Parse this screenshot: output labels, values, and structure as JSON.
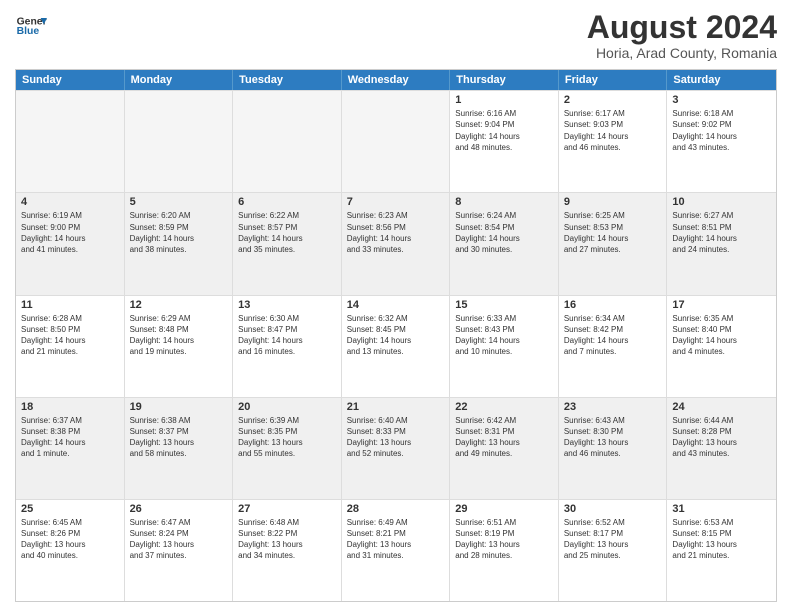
{
  "header": {
    "logo_line1": "General",
    "logo_line2": "Blue",
    "main_title": "August 2024",
    "subtitle": "Horia, Arad County, Romania"
  },
  "days_of_week": [
    "Sunday",
    "Monday",
    "Tuesday",
    "Wednesday",
    "Thursday",
    "Friday",
    "Saturday"
  ],
  "weeks": [
    [
      {
        "num": "",
        "info": "",
        "empty": true
      },
      {
        "num": "",
        "info": "",
        "empty": true
      },
      {
        "num": "",
        "info": "",
        "empty": true
      },
      {
        "num": "",
        "info": "",
        "empty": true
      },
      {
        "num": "1",
        "info": "Sunrise: 6:16 AM\nSunset: 9:04 PM\nDaylight: 14 hours\nand 48 minutes.",
        "empty": false
      },
      {
        "num": "2",
        "info": "Sunrise: 6:17 AM\nSunset: 9:03 PM\nDaylight: 14 hours\nand 46 minutes.",
        "empty": false
      },
      {
        "num": "3",
        "info": "Sunrise: 6:18 AM\nSunset: 9:02 PM\nDaylight: 14 hours\nand 43 minutes.",
        "empty": false
      }
    ],
    [
      {
        "num": "4",
        "info": "Sunrise: 6:19 AM\nSunset: 9:00 PM\nDaylight: 14 hours\nand 41 minutes.",
        "empty": false
      },
      {
        "num": "5",
        "info": "Sunrise: 6:20 AM\nSunset: 8:59 PM\nDaylight: 14 hours\nand 38 minutes.",
        "empty": false
      },
      {
        "num": "6",
        "info": "Sunrise: 6:22 AM\nSunset: 8:57 PM\nDaylight: 14 hours\nand 35 minutes.",
        "empty": false
      },
      {
        "num": "7",
        "info": "Sunrise: 6:23 AM\nSunset: 8:56 PM\nDaylight: 14 hours\nand 33 minutes.",
        "empty": false
      },
      {
        "num": "8",
        "info": "Sunrise: 6:24 AM\nSunset: 8:54 PM\nDaylight: 14 hours\nand 30 minutes.",
        "empty": false
      },
      {
        "num": "9",
        "info": "Sunrise: 6:25 AM\nSunset: 8:53 PM\nDaylight: 14 hours\nand 27 minutes.",
        "empty": false
      },
      {
        "num": "10",
        "info": "Sunrise: 6:27 AM\nSunset: 8:51 PM\nDaylight: 14 hours\nand 24 minutes.",
        "empty": false
      }
    ],
    [
      {
        "num": "11",
        "info": "Sunrise: 6:28 AM\nSunset: 8:50 PM\nDaylight: 14 hours\nand 21 minutes.",
        "empty": false
      },
      {
        "num": "12",
        "info": "Sunrise: 6:29 AM\nSunset: 8:48 PM\nDaylight: 14 hours\nand 19 minutes.",
        "empty": false
      },
      {
        "num": "13",
        "info": "Sunrise: 6:30 AM\nSunset: 8:47 PM\nDaylight: 14 hours\nand 16 minutes.",
        "empty": false
      },
      {
        "num": "14",
        "info": "Sunrise: 6:32 AM\nSunset: 8:45 PM\nDaylight: 14 hours\nand 13 minutes.",
        "empty": false
      },
      {
        "num": "15",
        "info": "Sunrise: 6:33 AM\nSunset: 8:43 PM\nDaylight: 14 hours\nand 10 minutes.",
        "empty": false
      },
      {
        "num": "16",
        "info": "Sunrise: 6:34 AM\nSunset: 8:42 PM\nDaylight: 14 hours\nand 7 minutes.",
        "empty": false
      },
      {
        "num": "17",
        "info": "Sunrise: 6:35 AM\nSunset: 8:40 PM\nDaylight: 14 hours\nand 4 minutes.",
        "empty": false
      }
    ],
    [
      {
        "num": "18",
        "info": "Sunrise: 6:37 AM\nSunset: 8:38 PM\nDaylight: 14 hours\nand 1 minute.",
        "empty": false
      },
      {
        "num": "19",
        "info": "Sunrise: 6:38 AM\nSunset: 8:37 PM\nDaylight: 13 hours\nand 58 minutes.",
        "empty": false
      },
      {
        "num": "20",
        "info": "Sunrise: 6:39 AM\nSunset: 8:35 PM\nDaylight: 13 hours\nand 55 minutes.",
        "empty": false
      },
      {
        "num": "21",
        "info": "Sunrise: 6:40 AM\nSunset: 8:33 PM\nDaylight: 13 hours\nand 52 minutes.",
        "empty": false
      },
      {
        "num": "22",
        "info": "Sunrise: 6:42 AM\nSunset: 8:31 PM\nDaylight: 13 hours\nand 49 minutes.",
        "empty": false
      },
      {
        "num": "23",
        "info": "Sunrise: 6:43 AM\nSunset: 8:30 PM\nDaylight: 13 hours\nand 46 minutes.",
        "empty": false
      },
      {
        "num": "24",
        "info": "Sunrise: 6:44 AM\nSunset: 8:28 PM\nDaylight: 13 hours\nand 43 minutes.",
        "empty": false
      }
    ],
    [
      {
        "num": "25",
        "info": "Sunrise: 6:45 AM\nSunset: 8:26 PM\nDaylight: 13 hours\nand 40 minutes.",
        "empty": false
      },
      {
        "num": "26",
        "info": "Sunrise: 6:47 AM\nSunset: 8:24 PM\nDaylight: 13 hours\nand 37 minutes.",
        "empty": false
      },
      {
        "num": "27",
        "info": "Sunrise: 6:48 AM\nSunset: 8:22 PM\nDaylight: 13 hours\nand 34 minutes.",
        "empty": false
      },
      {
        "num": "28",
        "info": "Sunrise: 6:49 AM\nSunset: 8:21 PM\nDaylight: 13 hours\nand 31 minutes.",
        "empty": false
      },
      {
        "num": "29",
        "info": "Sunrise: 6:51 AM\nSunset: 8:19 PM\nDaylight: 13 hours\nand 28 minutes.",
        "empty": false
      },
      {
        "num": "30",
        "info": "Sunrise: 6:52 AM\nSunset: 8:17 PM\nDaylight: 13 hours\nand 25 minutes.",
        "empty": false
      },
      {
        "num": "31",
        "info": "Sunrise: 6:53 AM\nSunset: 8:15 PM\nDaylight: 13 hours\nand 21 minutes.",
        "empty": false
      }
    ]
  ]
}
